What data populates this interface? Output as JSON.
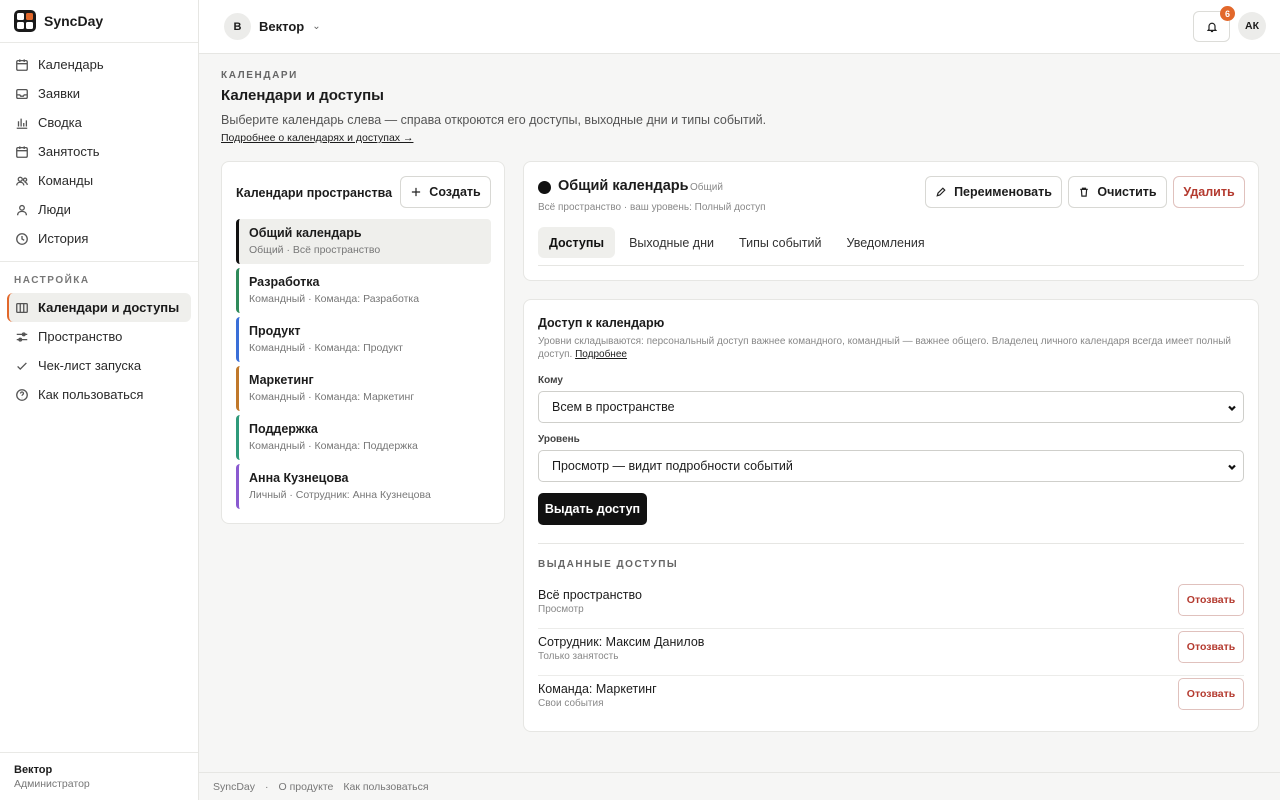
{
  "brand": {
    "name": "SyncDay"
  },
  "sidebar": {
    "items": [
      {
        "label": "Календарь",
        "icon": "calendar-icon"
      },
      {
        "label": "Заявки",
        "icon": "inbox-icon"
      },
      {
        "label": "Сводка",
        "icon": "bar-chart-icon"
      },
      {
        "label": "Занятость",
        "icon": "calendar-busy-icon"
      },
      {
        "label": "Команды",
        "icon": "users-icon"
      },
      {
        "label": "Люди",
        "icon": "user-icon"
      },
      {
        "label": "История",
        "icon": "clock-icon"
      }
    ],
    "section_title": "НАСТРОЙКА",
    "settings_items": [
      {
        "label": "Календари и доступы",
        "icon": "columns-icon",
        "active": true
      },
      {
        "label": "Пространство",
        "icon": "sliders-icon"
      },
      {
        "label": "Чек-лист запуска",
        "icon": "check-icon"
      },
      {
        "label": "Как пользоваться",
        "icon": "help-circle-icon"
      }
    ],
    "footer": {
      "name": "Вектор",
      "role": "Администратор"
    }
  },
  "topbar": {
    "workspace_initial": "В",
    "workspace_name": "Вектор",
    "notifications_count": "6",
    "user_initials": "АК"
  },
  "page": {
    "eyebrow": "КАЛЕНДАРИ",
    "title": "Календари и доступы",
    "description": "Выберите календарь слева — справа откроются его доступы, выходные дни и типы событий.",
    "link": "Подробнее о календарях и доступах →"
  },
  "calendars": {
    "heading": "Календари пространства",
    "create_label": "Создать",
    "items": [
      {
        "title": "Общий календарь",
        "subtitle": "Общий · Всё пространство",
        "color": "#111111",
        "selected": true
      },
      {
        "title": "Разработка",
        "subtitle": "Командный · Команда: Разработка",
        "color": "#2f8a5a"
      },
      {
        "title": "Продукт",
        "subtitle": "Командный · Команда: Продукт",
        "color": "#3a6fd8"
      },
      {
        "title": "Маркетинг",
        "subtitle": "Командный · Команда: Маркетинг",
        "color": "#c0782a"
      },
      {
        "title": "Поддержка",
        "subtitle": "Командный · Команда: Поддержка",
        "color": "#2f9a7a"
      },
      {
        "title": "Анна Кузнецова",
        "subtitle": "Личный · Сотрудник: Анна Кузнецова",
        "color": "#8a5ad0"
      }
    ]
  },
  "detail": {
    "title": "Общий календарь",
    "kind": "Общий",
    "meta": "Всё пространство · ваш уровень: Полный доступ",
    "rename_label": "Переименовать",
    "clear_label": "Очистить",
    "delete_label": "Удалить",
    "tabs": [
      "Доступы",
      "Выходные дни",
      "Типы событий",
      "Уведомления"
    ]
  },
  "access": {
    "title": "Доступ к календарю",
    "description": "Уровни складываются: персональный доступ важнее командного, командный — важнее общего. Владелец личного календаря всегда имеет полный доступ.",
    "more_link": "Подробнее",
    "to_label": "Кому",
    "to_value": "Всем в пространстве",
    "level_label": "Уровень",
    "level_value": "Просмотр — видит подробности событий",
    "grant_label": "Выдать доступ",
    "issued_title": "ВЫДАННЫЕ ДОСТУПЫ",
    "revoke_label": "Отозвать",
    "grants": [
      {
        "who": "Всё пространство",
        "level": "Просмотр"
      },
      {
        "who": "Сотрудник: Максим Данилов",
        "level": "Только занятость"
      },
      {
        "who": "Команда: Маркетинг",
        "level": "Свои события"
      }
    ]
  },
  "footer": {
    "brand": "SyncDay",
    "about": "О продукте",
    "howto": "Как пользоваться"
  },
  "colors": {
    "accent": "#e2682b",
    "danger": "#b43a2f",
    "primary_button": "#111111"
  }
}
